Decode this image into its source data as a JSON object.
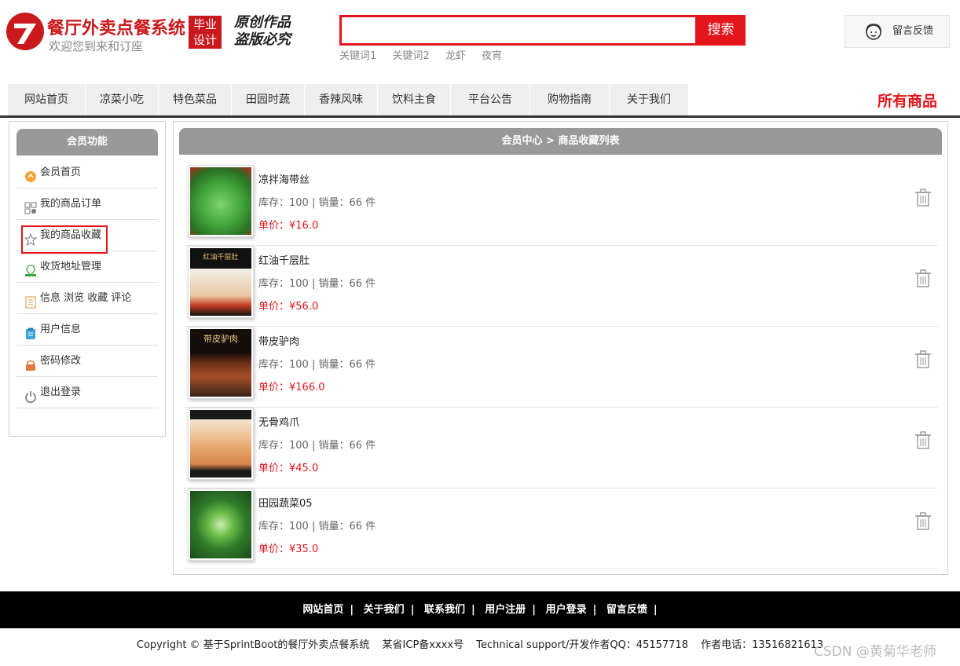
{
  "header": {
    "title": "餐厅外卖点餐系统",
    "subtitle": "欢迎您到来和订座",
    "badge": [
      "毕业",
      "设计"
    ],
    "original_line1": "原创作品",
    "original_line2": "盗版必究",
    "search_placeholder": "",
    "search_button": "搜索",
    "keywords": [
      "关键词1",
      "关键词2",
      "龙虾",
      "夜宵"
    ],
    "feedback": "留言反馈"
  },
  "nav": {
    "items": [
      "网站首页",
      "凉菜小吃",
      "特色菜品",
      "田园时蔬",
      "香辣风味",
      "饮料主食",
      "平台公告",
      "购物指南",
      "关于我们"
    ],
    "all_goods": "所有商品"
  },
  "sidebar": {
    "title": "会员功能",
    "items": [
      {
        "label": "会员首页",
        "icon": "member-home-icon"
      },
      {
        "label": "我的商品订单",
        "icon": "order-grid-icon"
      },
      {
        "label": "我的商品收藏",
        "icon": "star-icon"
      },
      {
        "label": "收货地址管理",
        "icon": "location-icon"
      },
      {
        "label": "信息 浏览 收藏 评论",
        "icon": "document-icon"
      },
      {
        "label": "用户信息",
        "icon": "clipboard-icon"
      },
      {
        "label": "密码修改",
        "icon": "lock-icon"
      },
      {
        "label": "退出登录",
        "icon": "power-icon"
      }
    ]
  },
  "main": {
    "breadcrumb": "会员中心 > 商品收藏列表",
    "items": [
      {
        "name": "凉拌海带丝",
        "meta": "库存：100 | 销量：66 件",
        "price": "单价：¥16.0",
        "pic_color": "#3fa43a"
      },
      {
        "name": "红油千层肚",
        "meta": "库存：100 | 销量：66 件",
        "price": "单价：¥56.0",
        "pic_color": "#e8d7c4",
        "pic_label": "红油千层肚"
      },
      {
        "name": "带皮驴肉",
        "meta": "库存：100 | 销量：66 件",
        "price": "单价：¥166.0",
        "pic_color": "#7a3a1e",
        "pic_label": "带皮驴肉"
      },
      {
        "name": "无骨鸡爪",
        "meta": "库存：100 | 销量：66 件",
        "price": "单价：¥45.0",
        "pic_color": "#e7b27a"
      },
      {
        "name": "田园蔬菜05",
        "meta": "库存：100 | 销量：66 件",
        "price": "单价：¥35.0",
        "pic_color": "#2f7a2a"
      }
    ]
  },
  "footer": {
    "links": [
      "网站首页",
      "关于我们",
      "联系我们",
      "用户注册",
      "用户登录",
      "留言反馈"
    ],
    "copyright": "Copyright © 基于SprintBoot的餐厅外卖点餐系统",
    "icp": "某省ICP备xxxx号",
    "support": "Technical support/开发作者QQ：45157718",
    "phone": "作者电话：13516821613"
  },
  "watermark": "CSDN @黄菊华老师",
  "colors": {
    "accent": "#e4161b",
    "brand": "#c9191d",
    "panel_head": "#999999"
  }
}
